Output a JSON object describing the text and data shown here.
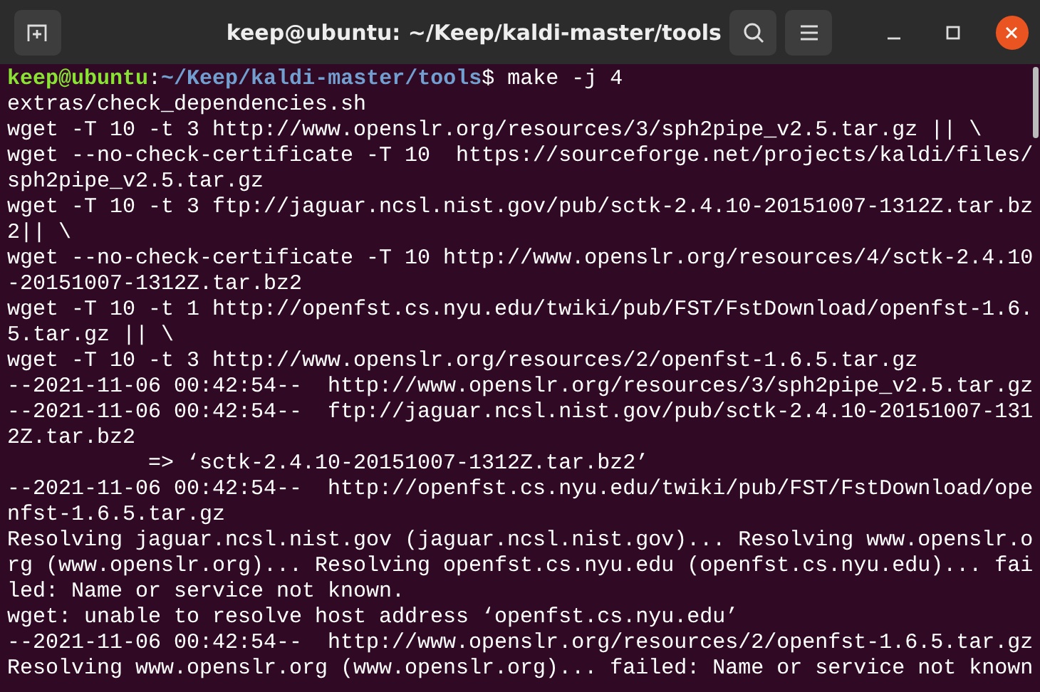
{
  "window": {
    "title": "keep@ubuntu: ~/Keep/kaldi-master/tools"
  },
  "terminal": {
    "prompt": {
      "user_host": "keep@ubuntu",
      "separator": ":",
      "path": "~/Keep/kaldi-master/tools",
      "command": "$ make -j 4"
    },
    "lines": [
      "extras/check_dependencies.sh",
      "wget -T 10 -t 3 http://www.openslr.org/resources/3/sph2pipe_v2.5.tar.gz || \\",
      "wget --no-check-certificate -T 10  https://sourceforge.net/projects/kaldi/files/",
      "sph2pipe_v2.5.tar.gz",
      "wget -T 10 -t 3 ftp://jaguar.ncsl.nist.gov/pub/sctk-2.4.10-20151007-1312Z.tar.bz",
      "2|| \\",
      "wget --no-check-certificate -T 10 http://www.openslr.org/resources/4/sctk-2.4.10",
      "-20151007-1312Z.tar.bz2",
      "wget -T 10 -t 1 http://openfst.cs.nyu.edu/twiki/pub/FST/FstDownload/openfst-1.6.",
      "5.tar.gz || \\",
      "wget -T 10 -t 3 http://www.openslr.org/resources/2/openfst-1.6.5.tar.gz",
      "--2021-11-06 00:42:54--  http://www.openslr.org/resources/3/sph2pipe_v2.5.tar.gz",
      "--2021-11-06 00:42:54--  ftp://jaguar.ncsl.nist.gov/pub/sctk-2.4.10-20151007-131",
      "2Z.tar.bz2",
      "           => ‘sctk-2.4.10-20151007-1312Z.tar.bz2’",
      "--2021-11-06 00:42:54--  http://openfst.cs.nyu.edu/twiki/pub/FST/FstDownload/ope",
      "nfst-1.6.5.tar.gz",
      "Resolving jaguar.ncsl.nist.gov (jaguar.ncsl.nist.gov)... Resolving www.openslr.o",
      "rg (www.openslr.org)... Resolving openfst.cs.nyu.edu (openfst.cs.nyu.edu)... fai",
      "led: Name or service not known.",
      "wget: unable to resolve host address ‘openfst.cs.nyu.edu’",
      "--2021-11-06 00:42:54--  http://www.openslr.org/resources/2/openfst-1.6.5.tar.gz",
      "Resolving www.openslr.org (www.openslr.org)... failed: Name or service not known"
    ]
  }
}
